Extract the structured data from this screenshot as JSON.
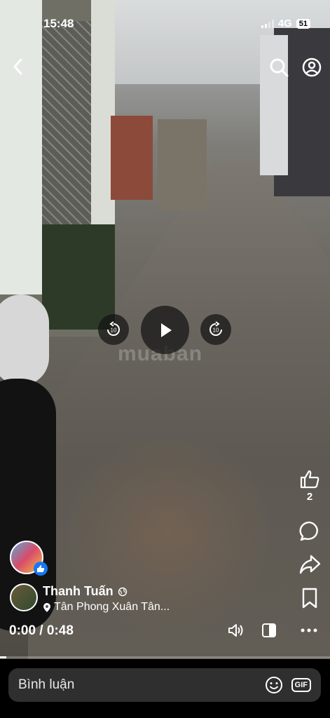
{
  "status_bar": {
    "time": "15:48",
    "network": "4G",
    "battery": "51"
  },
  "video": {
    "watermark": "muaban",
    "play_state": "paused",
    "current_time": "0:00",
    "duration": "0:48",
    "progress": 0.02
  },
  "post": {
    "author": "Thanh Tuấn",
    "location": "Tân Phong Xuân Tân..."
  },
  "actions": {
    "like_count": "2"
  },
  "comment_bar": {
    "placeholder": "Bình luận",
    "gif_label": "GIF"
  },
  "icons": {
    "back": "chevron-left-icon",
    "search": "search-icon",
    "profile": "profile-icon",
    "rewind": "rewind-10-icon",
    "play": "play-icon",
    "forward": "forward-10-icon",
    "like": "thumbs-up-icon",
    "comment": "comment-icon",
    "share": "share-icon",
    "save": "bookmark-icon",
    "volume": "volume-icon",
    "caption": "caption-toggle-icon",
    "more": "more-icon",
    "emoji": "emoji-icon"
  },
  "colors": {
    "accent": "#1877f2",
    "comment_bar": "#2f2f30"
  }
}
